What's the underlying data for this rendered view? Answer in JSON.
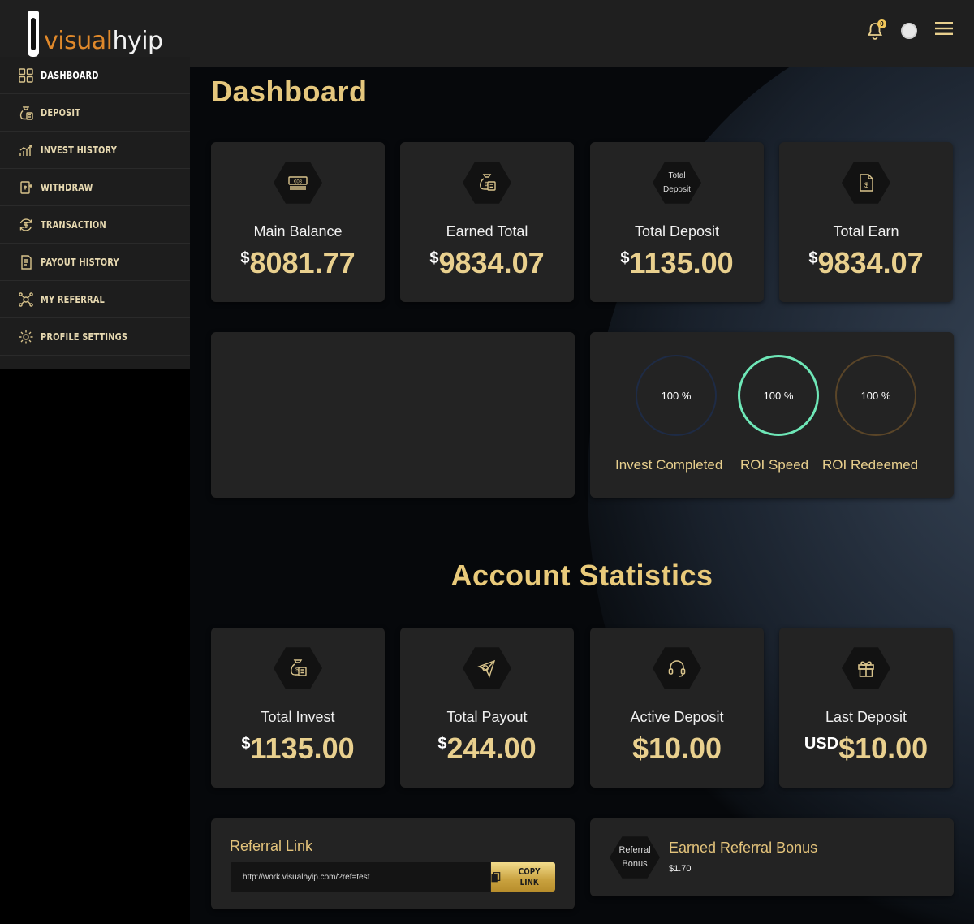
{
  "brand": {
    "logo_part1": "visual",
    "logo_part2": "hyip"
  },
  "topbar": {
    "notification_count": "0"
  },
  "sidebar": {
    "items": [
      {
        "label": "DASHBOARD",
        "icon": "grid-icon"
      },
      {
        "label": "DEPOSIT",
        "icon": "money-bag-icon"
      },
      {
        "label": "INVEST HISTORY",
        "icon": "chart-icon"
      },
      {
        "label": "WITHDRAW",
        "icon": "withdraw-icon"
      },
      {
        "label": "TRANSACTION",
        "icon": "dollar-cycle-icon"
      },
      {
        "label": "PAYOUT HISTORY",
        "icon": "invoice-icon"
      },
      {
        "label": "MY REFERRAL",
        "icon": "network-icon"
      },
      {
        "label": "PROFILE SETTINGS",
        "icon": "gear-icon"
      }
    ]
  },
  "dashboard": {
    "title": "Dashboard",
    "cards": [
      {
        "label": "Main Balance",
        "currency": "$",
        "value": "8081.77",
        "icon": "cash-icon"
      },
      {
        "label": "Earned Total",
        "currency": "$",
        "value": "9834.07",
        "icon": "money-bag-icon"
      },
      {
        "label": "Total Deposit",
        "currency": "$",
        "value": "1135.00",
        "icon_text_1": "Total",
        "icon_text_2": "Deposit"
      },
      {
        "label": "Total Earn",
        "currency": "$",
        "value": "9834.07",
        "icon": "document-dollar-icon"
      }
    ],
    "rings": [
      {
        "label": "Invest Completed",
        "value": "100 %",
        "color": "#1e2b45"
      },
      {
        "label": "ROI Speed",
        "value": "100 %",
        "color": "#6ee7b7"
      },
      {
        "label": "ROI Redeemed",
        "value": "100 %",
        "color": "#5a4528"
      }
    ]
  },
  "statistics": {
    "title": "Account Statistics",
    "cards": [
      {
        "label": "Total Invest",
        "currency": "$",
        "value": "1135.00",
        "icon": "money-bag-icon"
      },
      {
        "label": "Total Payout",
        "currency": "$",
        "value": "244.00",
        "icon": "paper-plane-icon"
      },
      {
        "label": "Active Deposit",
        "currency": "",
        "value": "$10.00",
        "icon": "headset-icon"
      },
      {
        "label": "Last Deposit",
        "currency": "USD",
        "value": "$10.00",
        "icon": "gift-icon"
      }
    ]
  },
  "referral": {
    "title": "Referral Link",
    "link": "http://work.visualhyip.com/?ref=test",
    "copy_label": "COPY LINK"
  },
  "bonus": {
    "icon_text_1": "Referral",
    "icon_text_2": "Bonus",
    "title": "Earned Referral Bonus",
    "value": "$1.70"
  },
  "colors": {
    "accent": "#e9d08e",
    "orange": "#e0892b",
    "card": "#232323"
  }
}
